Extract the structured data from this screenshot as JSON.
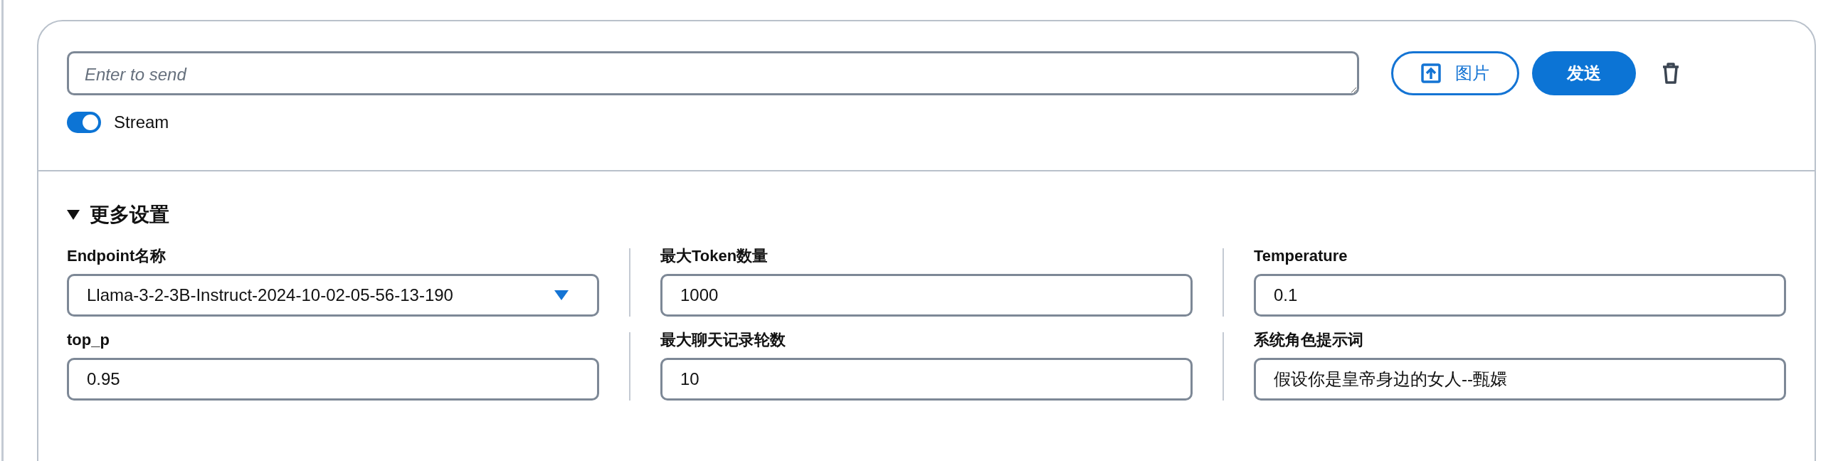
{
  "message": {
    "placeholder": "Enter to send"
  },
  "buttons": {
    "image": "图片",
    "send": "发送"
  },
  "stream": {
    "label": "Stream",
    "on": true
  },
  "settings": {
    "title": "更多设置",
    "expanded": true,
    "fields": [
      {
        "kind": "select",
        "label": "Endpoint名称",
        "value": "Llama-3-2-3B-Instruct-2024-10-02-05-56-13-190"
      },
      {
        "kind": "input",
        "label": "最大Token数量",
        "value": "1000"
      },
      {
        "kind": "input",
        "label": "Temperature",
        "value": "0.1"
      },
      {
        "kind": "input",
        "label": "top_p",
        "value": "0.95"
      },
      {
        "kind": "input",
        "label": "最大聊天记录轮数",
        "value": "10"
      },
      {
        "kind": "input",
        "label": "系统角色提示词",
        "value": "假设你是皇帝身边的女人--甄嬛"
      }
    ]
  }
}
